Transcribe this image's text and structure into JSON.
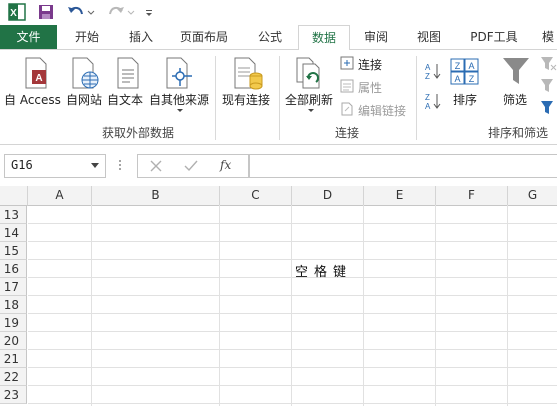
{
  "quick_access": {
    "excel_icon": "excel-logo-icon",
    "save_icon": "save-icon",
    "undo_icon": "undo-icon",
    "redo_icon": "redo-icon",
    "customize_icon": "customize-qat-icon"
  },
  "tabs": [
    {
      "label": "文件"
    },
    {
      "label": "开始"
    },
    {
      "label": "插入"
    },
    {
      "label": "页面布局"
    },
    {
      "label": "公式"
    },
    {
      "label": "数据"
    },
    {
      "label": "审阅"
    },
    {
      "label": "视图"
    },
    {
      "label": "PDF工具"
    },
    {
      "label": "模"
    }
  ],
  "ribbon": {
    "groups": {
      "external": {
        "label": "获取外部数据",
        "buttons": [
          "自 Access",
          "自网站",
          "自文本",
          "自其他来源"
        ]
      },
      "existing": {
        "label": "现有连接"
      },
      "connections": {
        "label": "连接",
        "refresh": "全部刷新",
        "connect": "连接",
        "properties": "属性",
        "edit_links": "编辑链接"
      },
      "sort": {
        "label": "排序和筛选",
        "sort": "排序",
        "filter": "筛选"
      }
    }
  },
  "formula_bar": {
    "name_box": "G16",
    "fx": "fx",
    "formula": ""
  },
  "sheet": {
    "columns": [
      "A",
      "B",
      "C",
      "D",
      "E",
      "F",
      "G"
    ],
    "rows": [
      "13",
      "14",
      "15",
      "16",
      "17",
      "18",
      "19",
      "20",
      "21",
      "22",
      "23"
    ],
    "cell_D16": "空格键"
  },
  "colors": {
    "accent": "#217346",
    "grid": "#e1e1e1",
    "header_bg": "#f3f3f3"
  }
}
